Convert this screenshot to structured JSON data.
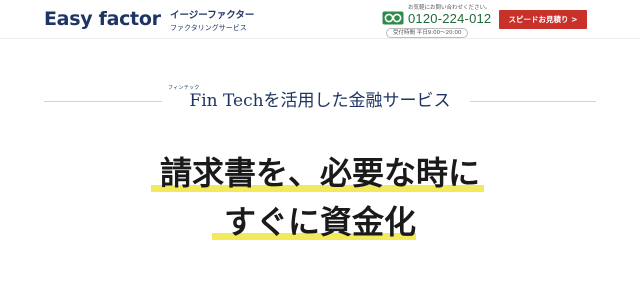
{
  "header": {
    "logo_text": "Easy factor",
    "brand_name": "イージーファクター",
    "brand_sub": "ファクタリングサービス",
    "phone_note": "お気軽にお問い合わせください。",
    "phone_number": "0120-224-012",
    "hours": "受付時間 平日9:00～20:00",
    "quote_button": "スピードお見積り >"
  },
  "hero": {
    "ruby": "フィンテック",
    "tagline": "Fin Techを活用した金融サービス",
    "headline_line1": "請求書を、必要な時に",
    "headline_line2": "すぐに資金化",
    "highlight_color": "#f2ea5a"
  },
  "colors": {
    "brand_navy": "#1e3564",
    "cta_red": "#c8302a",
    "phone_green": "#1f6b3a"
  },
  "icons": {
    "freedial": "freedial-icon"
  }
}
